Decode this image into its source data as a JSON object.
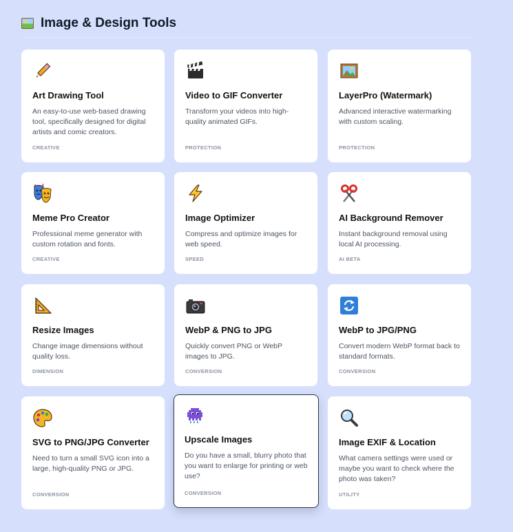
{
  "section": {
    "icon": "framed-picture-icon",
    "title": "Image & Design Tools"
  },
  "cards": [
    {
      "icon": "pencil-icon",
      "title": "Art Drawing Tool",
      "description": "An easy-to-use web-based drawing tool, specifically designed for digital artists and comic creators.",
      "tag": "CREATIVE"
    },
    {
      "icon": "clapper-board-icon",
      "title": "Video to GIF Converter",
      "description": "Transform your videos into high-quality animated GIFs.",
      "tag": "PROTECTION"
    },
    {
      "icon": "framed-picture-icon",
      "title": "LayerPro (Watermark)",
      "description": "Advanced interactive watermarking with custom scaling.",
      "tag": "PROTECTION"
    },
    {
      "icon": "performing-arts-icon",
      "title": "Meme Pro Creator",
      "description": "Professional meme generator with custom rotation and fonts.",
      "tag": "CREATIVE"
    },
    {
      "icon": "lightning-icon",
      "title": "Image Optimizer",
      "description": "Compress and optimize images for web speed.",
      "tag": "SPEED"
    },
    {
      "icon": "scissors-icon",
      "title": "AI Background Remover",
      "description": "Instant background removal using local AI processing.",
      "tag": "AI BETA"
    },
    {
      "icon": "triangular-ruler-icon",
      "title": "Resize Images",
      "description": "Change image dimensions without quality loss.",
      "tag": "DIMENSION"
    },
    {
      "icon": "camera-icon",
      "title": "WebP & PNG to JPG",
      "description": "Quickly convert PNG or WebP images to JPG.",
      "tag": "CONVERSION"
    },
    {
      "icon": "refresh-arrows-icon",
      "title": "WebP to JPG/PNG",
      "description": "Convert modern WebP format back to standard formats.",
      "tag": "CONVERSION"
    },
    {
      "icon": "artist-palette-icon",
      "title": "SVG to PNG/JPG Converter",
      "description": "Need to turn a small SVG icon into a large, high-quality PNG or JPG.",
      "tag": "CONVERSION"
    },
    {
      "icon": "pixel-monster-icon",
      "title": "Upscale Images",
      "description": "Do you have a small, blurry photo that you want to enlarge for printing or web use?",
      "tag": "CONVERSION"
    },
    {
      "icon": "magnifying-glass-icon",
      "title": "Image EXIF & Location",
      "description": "What camera settings were used or maybe you want to check where the photo was taken?",
      "tag": "UTILITY"
    }
  ]
}
